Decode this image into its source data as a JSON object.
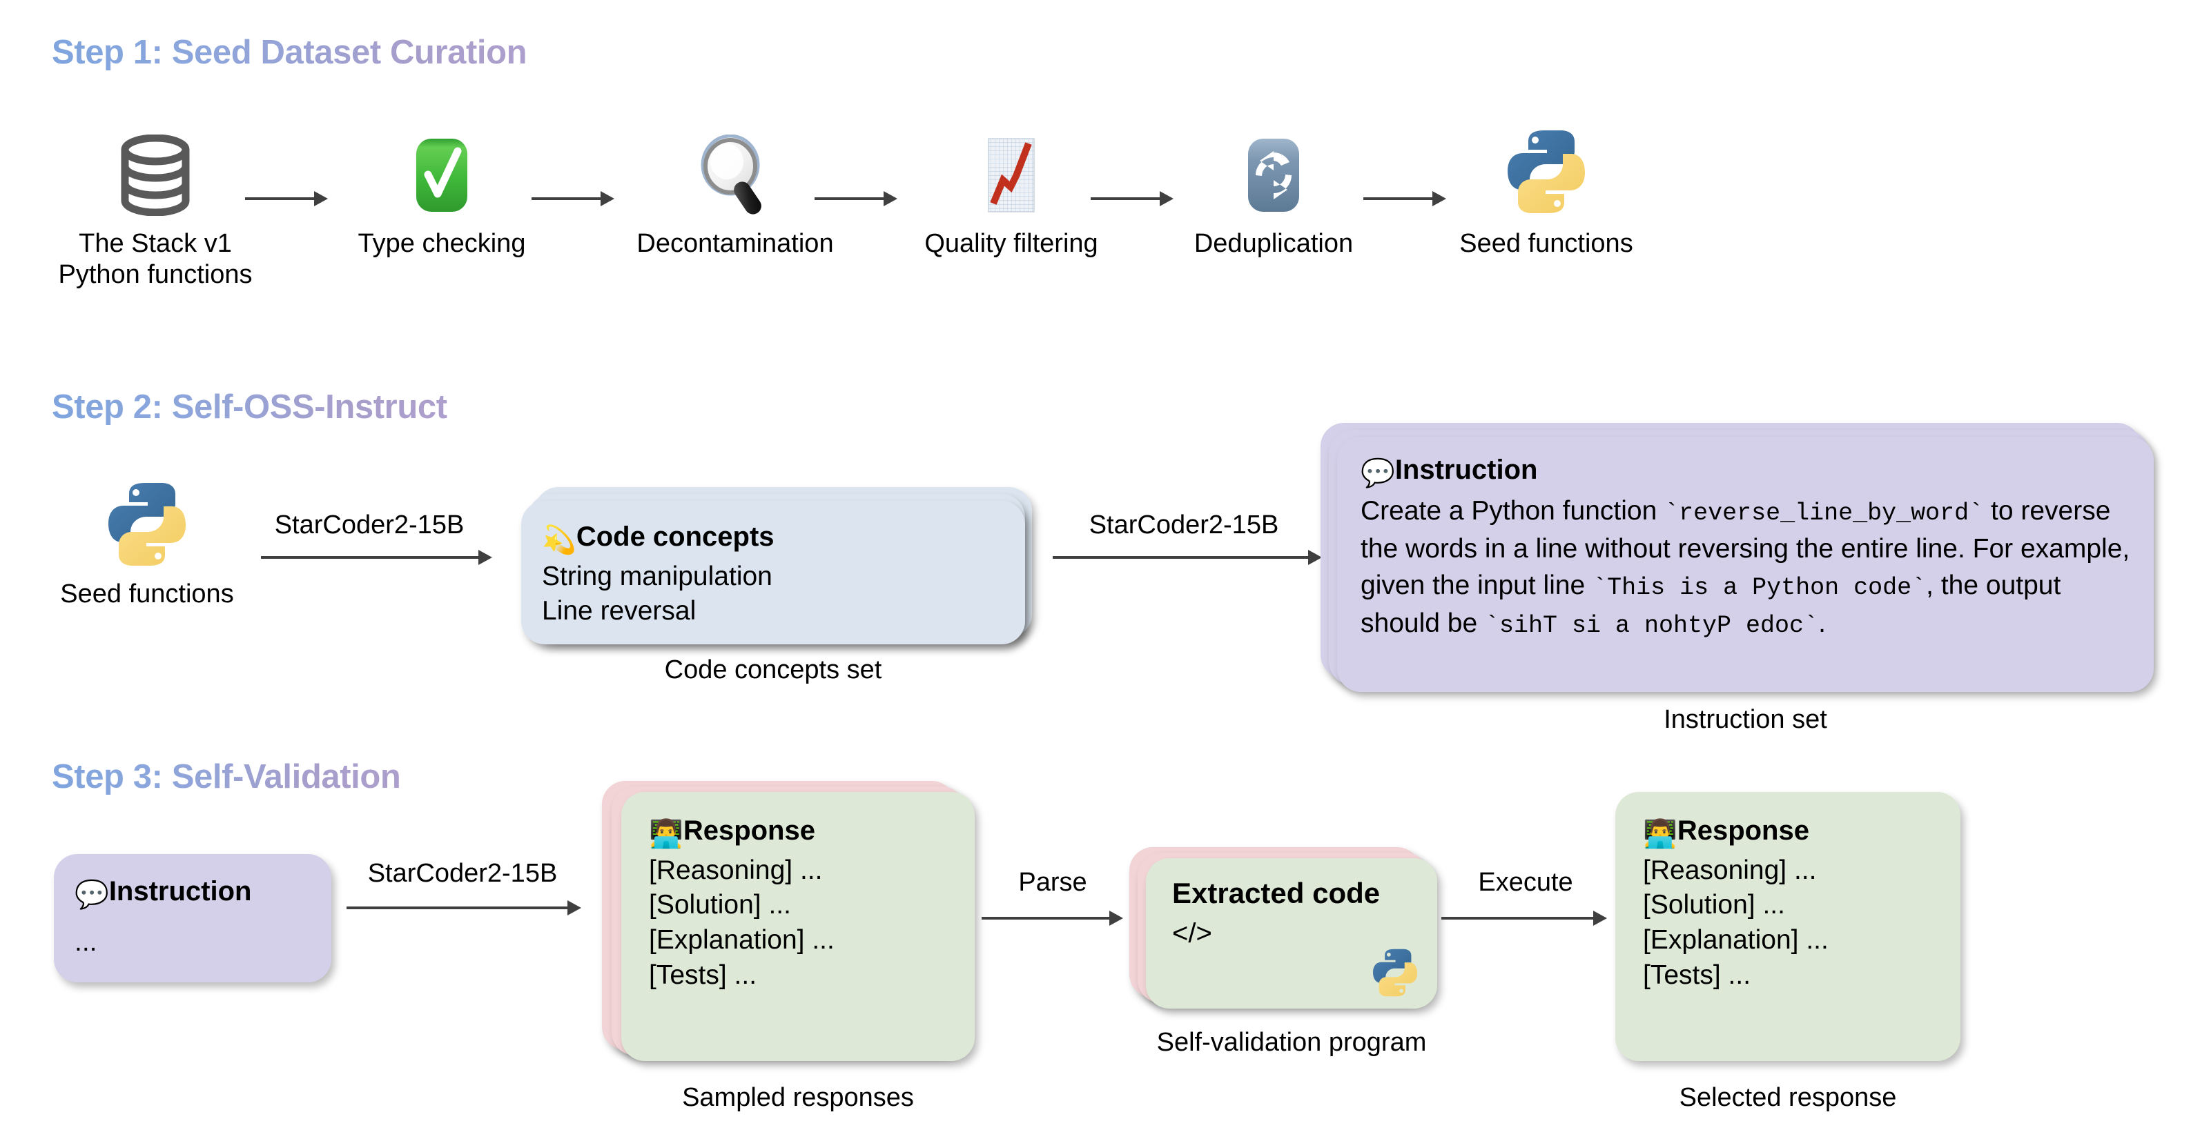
{
  "steps": [
    {
      "heading": "Step 1: Seed Dataset Curation"
    },
    {
      "heading": "Step 2: Self-OSS-Instruct"
    },
    {
      "heading": "Step 3: Self-Validation"
    }
  ],
  "step1": {
    "pipeline": [
      {
        "icon": "database-icon",
        "caption": "The Stack v1\nPython functions"
      },
      {
        "icon": "green-check-icon",
        "caption": "Type checking"
      },
      {
        "icon": "magnifying-glass-icon",
        "caption": "Decontamination"
      },
      {
        "icon": "chart-increasing-icon",
        "caption": "Quality filtering"
      },
      {
        "icon": "refresh-sync-icon",
        "caption": "Deduplication"
      },
      {
        "icon": "python-logo-icon",
        "caption": "Seed functions"
      }
    ]
  },
  "step2": {
    "source_caption": "Seed functions",
    "arrow1_label": "StarCoder2-15B",
    "arrow2_label": "StarCoder2-15B",
    "concepts_card": {
      "emoji": "💫",
      "title": "Code concepts",
      "lines": [
        "String manipulation",
        "Line reversal"
      ]
    },
    "concepts_caption": "Code concepts set",
    "instruction_card": {
      "emoji": "💬",
      "title": "Instruction",
      "text_parts": [
        {
          "t": "Create a Python function ",
          "code": false
        },
        {
          "t": "`reverse_line_by_word`",
          "code": true
        },
        {
          "t": " to reverse the words in a line without reversing the entire line. For example, given the input line ",
          "code": false
        },
        {
          "t": "`This is a Python code`",
          "code": true
        },
        {
          "t": ", the output should be ",
          "code": false
        },
        {
          "t": "`sihT si a nohtyP edoc`",
          "code": true
        },
        {
          "t": ".",
          "code": false
        }
      ]
    },
    "instruction_caption": "Instruction set"
  },
  "step3": {
    "instruction_card": {
      "emoji": "💬",
      "title": "Instruction",
      "ellipsis": "..."
    },
    "arrow_model_label": "StarCoder2-15B",
    "arrow_parse_label": "Parse",
    "arrow_execute_label": "Execute",
    "sampled_card": {
      "emoji": "👨‍💻",
      "title": "Response",
      "lines": [
        "[Reasoning] ...",
        "[Solution] ...",
        "[Explanation] ...",
        "[Tests] ..."
      ]
    },
    "sampled_caption": "Sampled responses",
    "code_card": {
      "title": "Extracted code",
      "code_glyph": "</>",
      "icon": "python-logo-icon"
    },
    "code_caption": "Self-validation program",
    "selected_card": {
      "emoji": "👨‍💻",
      "title": "Response",
      "lines": [
        "[Reasoning] ...",
        "[Solution] ...",
        "[Explanation] ...",
        "[Tests] ..."
      ]
    },
    "selected_caption": "Selected response"
  },
  "colors": {
    "heading_gradient_start": "#7fa4dd",
    "heading_gradient_end": "#a99ecb",
    "card_blue": "#dce5ef",
    "card_lavender": "#d5d0e9",
    "card_green": "#dde9d6",
    "card_pink": "#f2d4d6",
    "arrow": "#3f3f3f"
  }
}
